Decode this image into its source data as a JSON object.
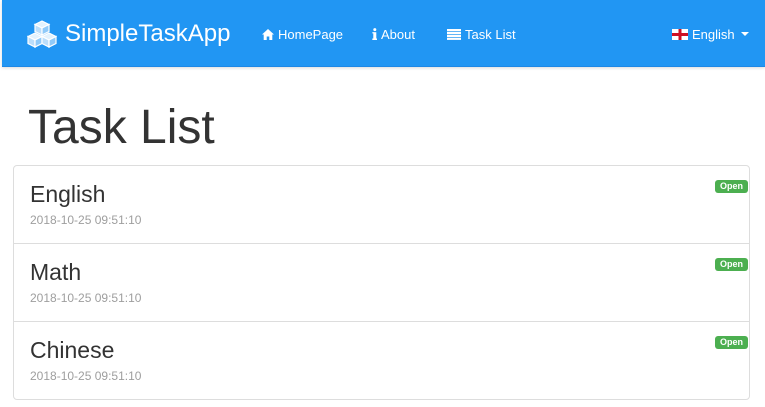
{
  "app": {
    "brand": "SimpleTaskApp",
    "brand_icon": "cubes-icon",
    "accent_color": "#2196f3"
  },
  "nav": {
    "home": "HomePage",
    "about": "About",
    "task_list": "Task List",
    "language": "English",
    "language_flag": "england-flag-icon"
  },
  "page": {
    "title": "Task List"
  },
  "tasks": [
    {
      "name": "English",
      "date": "2018-10-25 09:51:10",
      "status": "Open"
    },
    {
      "name": "Math",
      "date": "2018-10-25 09:51:10",
      "status": "Open"
    },
    {
      "name": "Chinese",
      "date": "2018-10-25 09:51:10",
      "status": "Open"
    }
  ],
  "status_colors": {
    "open": "#4caf50"
  }
}
